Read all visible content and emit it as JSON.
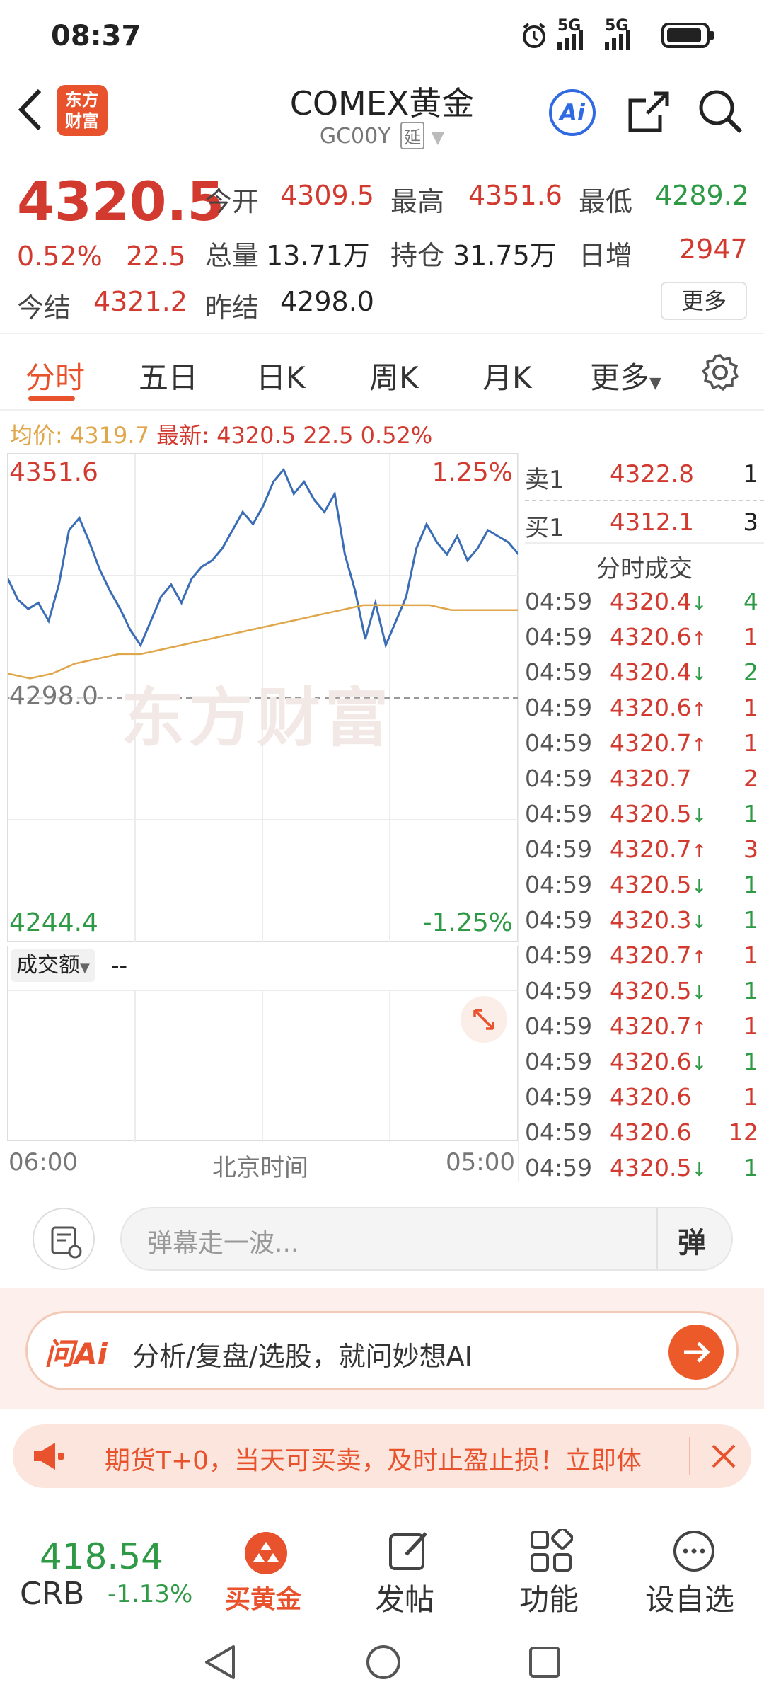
{
  "status_bar": {
    "time": "08:37",
    "sig1": "5G",
    "sig2": "5G"
  },
  "header": {
    "title": "COMEX黄金",
    "subtitle": "GC00Y",
    "delay_badge": "延",
    "logo_line1": "东方",
    "logo_line2": "财富",
    "ai_label": "Ai"
  },
  "quote": {
    "last": "4320.5",
    "change_pct": "0.52%",
    "change": "22.5",
    "open_label": "今开",
    "open": "4309.5",
    "high_label": "最高",
    "high": "4351.6",
    "low_label": "最低",
    "low": "4289.2",
    "volume_label": "总量",
    "volume": "13.71万",
    "oi_label": "持仓",
    "oi": "31.75万",
    "daily_inc_label": "日增",
    "daily_inc": "2947",
    "settle_label": "今结",
    "settle": "4321.2",
    "prev_settle_label": "昨结",
    "prev_settle": "4298.0",
    "more_button": "更多"
  },
  "tabs": [
    "分时",
    "五日",
    "日K",
    "周K",
    "月K",
    "更多"
  ],
  "info_line": {
    "avg_label": "均价:",
    "avg": "4319.7",
    "latest_label": "最新:",
    "latest": "4320.5",
    "change": "22.5",
    "change_pct": "0.52%"
  },
  "chart": {
    "top_price": "4351.6",
    "top_pct": "1.25%",
    "mid_price": "4298.0",
    "bottom_price": "4244.4",
    "bottom_pct": "-1.25%",
    "watermark": "东方财富",
    "volume_selector": "成交额",
    "volume_value": "--",
    "time_start": "06:00",
    "time_mid": "北京时间",
    "time_end": "05:00",
    "colors": {
      "price_line": "#3a6db5",
      "avg_line": "#e0a64a",
      "up": "#d23a2f",
      "down": "#2e9a45"
    }
  },
  "order_book": {
    "ask_label": "卖1",
    "ask_price": "4322.8",
    "ask_volume": "1",
    "bid_label": "买1",
    "bid_price": "4312.1",
    "bid_volume": "3"
  },
  "trades_title": "分时成交",
  "trades": [
    {
      "time": "04:59",
      "price": "4320.4",
      "dir": "down",
      "vol": "4",
      "vol_color": "green"
    },
    {
      "time": "04:59",
      "price": "4320.6",
      "dir": "up",
      "vol": "1",
      "vol_color": "red"
    },
    {
      "time": "04:59",
      "price": "4320.4",
      "dir": "down",
      "vol": "2",
      "vol_color": "green"
    },
    {
      "time": "04:59",
      "price": "4320.6",
      "dir": "up",
      "vol": "1",
      "vol_color": "red"
    },
    {
      "time": "04:59",
      "price": "4320.7",
      "dir": "up",
      "vol": "1",
      "vol_color": "red"
    },
    {
      "time": "04:59",
      "price": "4320.7",
      "dir": "",
      "vol": "2",
      "vol_color": "red"
    },
    {
      "time": "04:59",
      "price": "4320.5",
      "dir": "down",
      "vol": "1",
      "vol_color": "green"
    },
    {
      "time": "04:59",
      "price": "4320.7",
      "dir": "up",
      "vol": "3",
      "vol_color": "red"
    },
    {
      "time": "04:59",
      "price": "4320.5",
      "dir": "down",
      "vol": "1",
      "vol_color": "green"
    },
    {
      "time": "04:59",
      "price": "4320.3",
      "dir": "down",
      "vol": "1",
      "vol_color": "green"
    },
    {
      "time": "04:59",
      "price": "4320.7",
      "dir": "up",
      "vol": "1",
      "vol_color": "red"
    },
    {
      "time": "04:59",
      "price": "4320.5",
      "dir": "down",
      "vol": "1",
      "vol_color": "green"
    },
    {
      "time": "04:59",
      "price": "4320.7",
      "dir": "up",
      "vol": "1",
      "vol_color": "red"
    },
    {
      "time": "04:59",
      "price": "4320.6",
      "dir": "down",
      "vol": "1",
      "vol_color": "green"
    },
    {
      "time": "04:59",
      "price": "4320.6",
      "dir": "",
      "vol": "1",
      "vol_color": "red"
    },
    {
      "time": "04:59",
      "price": "4320.6",
      "dir": "",
      "vol": "12",
      "vol_color": "red"
    },
    {
      "time": "04:59",
      "price": "4320.5",
      "dir": "down",
      "vol": "1",
      "vol_color": "green"
    }
  ],
  "comment": {
    "placeholder": "弹幕走一波...",
    "danmu_btn": "弹"
  },
  "ai_bar": {
    "brand": "问Ai",
    "text": "分析/复盘/选股，就问妙想AI"
  },
  "notice": {
    "text": "期货T+0，当天可买卖，及时止盈止损！立即体"
  },
  "bottom_nav": {
    "index_value": "418.54",
    "index_name": "CRB",
    "index_change": "-1.13%",
    "buy_gold": "买黄金",
    "post": "发帖",
    "functions": "功能",
    "watchlist": "设自选"
  }
}
